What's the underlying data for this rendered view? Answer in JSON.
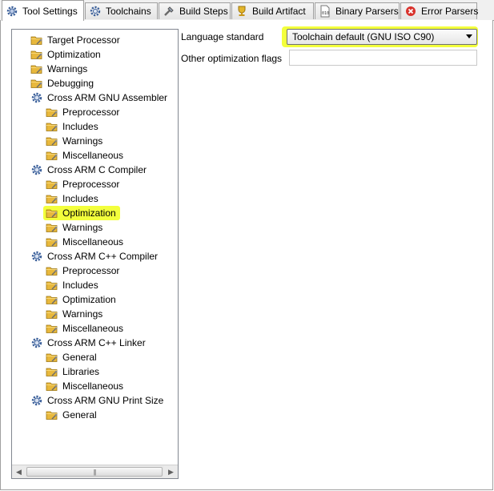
{
  "tabs": [
    {
      "label": "Tool Settings",
      "icon": "gear-settings-icon",
      "active": true
    },
    {
      "label": "Toolchains",
      "icon": "gear-toolchain-icon",
      "active": false
    },
    {
      "label": "Build Steps",
      "icon": "build-steps-icon",
      "active": false
    },
    {
      "label": "Build Artifact",
      "icon": "trophy-icon",
      "active": false
    },
    {
      "label": "Binary Parsers",
      "icon": "binary-file-icon",
      "active": false
    },
    {
      "label": "Error Parsers",
      "icon": "error-icon",
      "active": false
    }
  ],
  "tree": [
    {
      "label": "Target Processor",
      "level": 1,
      "icon": "options-folder-icon"
    },
    {
      "label": "Optimization",
      "level": 1,
      "icon": "options-folder-icon"
    },
    {
      "label": "Warnings",
      "level": 1,
      "icon": "options-folder-icon"
    },
    {
      "label": "Debugging",
      "level": 1,
      "icon": "options-folder-icon"
    },
    {
      "label": "Cross ARM GNU Assembler",
      "level": 1,
      "icon": "tool-gear-icon"
    },
    {
      "label": "Preprocessor",
      "level": 2,
      "icon": "options-folder-icon"
    },
    {
      "label": "Includes",
      "level": 2,
      "icon": "options-folder-icon"
    },
    {
      "label": "Warnings",
      "level": 2,
      "icon": "options-folder-icon"
    },
    {
      "label": "Miscellaneous",
      "level": 2,
      "icon": "options-folder-icon"
    },
    {
      "label": "Cross ARM C Compiler",
      "level": 1,
      "icon": "tool-gear-icon"
    },
    {
      "label": "Preprocessor",
      "level": 2,
      "icon": "options-folder-icon"
    },
    {
      "label": "Includes",
      "level": 2,
      "icon": "options-folder-icon"
    },
    {
      "label": "Optimization",
      "level": 2,
      "icon": "options-folder-icon",
      "selected": true
    },
    {
      "label": "Warnings",
      "level": 2,
      "icon": "options-folder-icon"
    },
    {
      "label": "Miscellaneous",
      "level": 2,
      "icon": "options-folder-icon"
    },
    {
      "label": "Cross ARM C++ Compiler",
      "level": 1,
      "icon": "tool-gear-icon"
    },
    {
      "label": "Preprocessor",
      "level": 2,
      "icon": "options-folder-icon"
    },
    {
      "label": "Includes",
      "level": 2,
      "icon": "options-folder-icon"
    },
    {
      "label": "Optimization",
      "level": 2,
      "icon": "options-folder-icon"
    },
    {
      "label": "Warnings",
      "level": 2,
      "icon": "options-folder-icon"
    },
    {
      "label": "Miscellaneous",
      "level": 2,
      "icon": "options-folder-icon"
    },
    {
      "label": "Cross ARM C++ Linker",
      "level": 1,
      "icon": "tool-gear-icon"
    },
    {
      "label": "General",
      "level": 2,
      "icon": "options-folder-icon"
    },
    {
      "label": "Libraries",
      "level": 2,
      "icon": "options-folder-icon"
    },
    {
      "label": "Miscellaneous",
      "level": 2,
      "icon": "options-folder-icon"
    },
    {
      "label": "Cross ARM GNU Print Size",
      "level": 1,
      "icon": "tool-gear-icon"
    },
    {
      "label": "General",
      "level": 2,
      "icon": "options-folder-icon"
    }
  ],
  "form": {
    "language_standard_label": "Language standard",
    "language_standard_value": "Toolchain default (GNU ISO C90)",
    "other_flags_label": "Other optimization flags",
    "other_flags_value": ""
  },
  "colors": {
    "highlight": "#f3ff3c",
    "folder": "#e8b83c"
  }
}
